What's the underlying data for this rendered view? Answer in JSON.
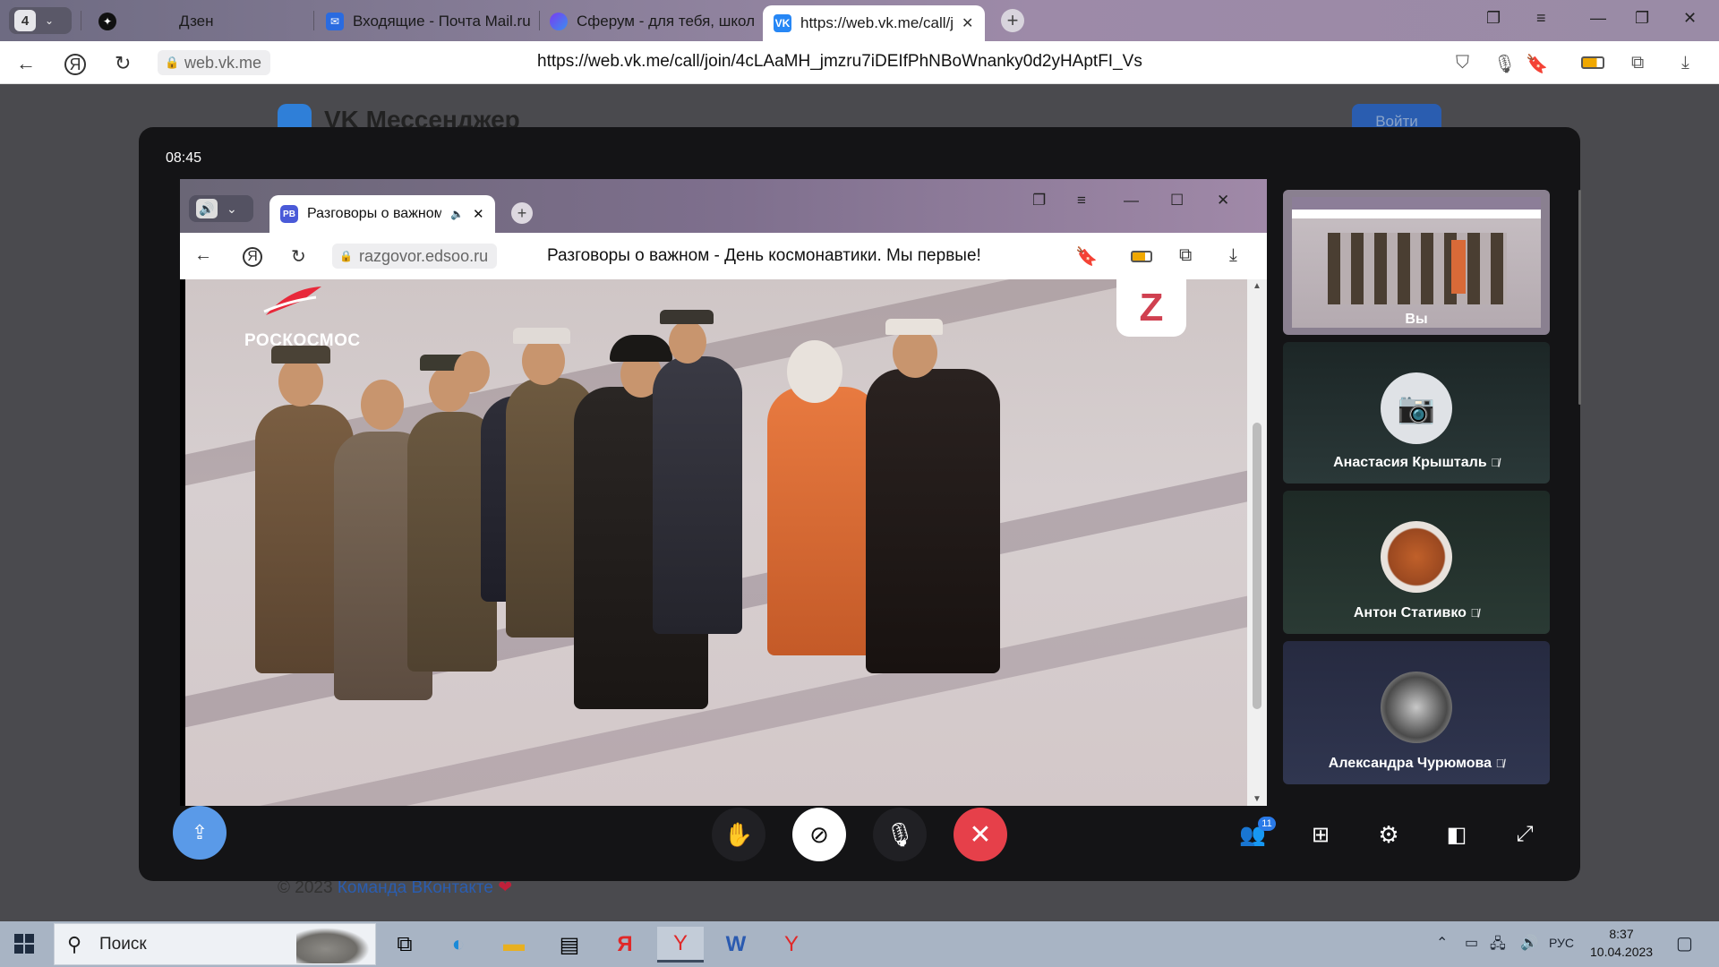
{
  "browser": {
    "tab_count": "4",
    "tabs": [
      {
        "label": "Дзен"
      },
      {
        "label": "Входящие - Почта Mail.ru"
      },
      {
        "label": "Сферум - для тебя, школь"
      },
      {
        "label": "https://web.vk.me/call/jo"
      }
    ],
    "domain": "web.vk.me",
    "url": "https://web.vk.me/call/join/4cLAaMH_jmzru7iDEIfPhNBoWnanky0d2yHAptFI_Vs"
  },
  "vk_page": {
    "title": "VK Мессенджер",
    "login_label": "Войти",
    "footer_prefix": "© 2023 ",
    "footer_link": "Команда ВКонтакте",
    "footer_heart": "❤"
  },
  "call": {
    "timer": "08:45",
    "shared_screen": {
      "tab_title": "Разговоры о важном",
      "tab_favicon": "РВ",
      "domain": "razgovor.edsoo.ru",
      "page_title": "Разговоры о важном - День космонавтики. Мы первые!",
      "video_logo": "РОСКОСМОС",
      "video_corner_logo": "Z"
    },
    "participants": [
      {
        "name": "Вы"
      },
      {
        "name": "Анастасия Крышталь"
      },
      {
        "name": "Антон Стативко"
      },
      {
        "name": "Александра Чурюмова"
      }
    ],
    "participants_count": "11",
    "colors": {
      "end_call": "#e6404a",
      "share": "#5a9ae8",
      "tile_bg": "#243030"
    }
  },
  "taskbar": {
    "search_label": "Поиск",
    "language": "РУС",
    "time": "8:37",
    "date": "10.04.2023"
  }
}
